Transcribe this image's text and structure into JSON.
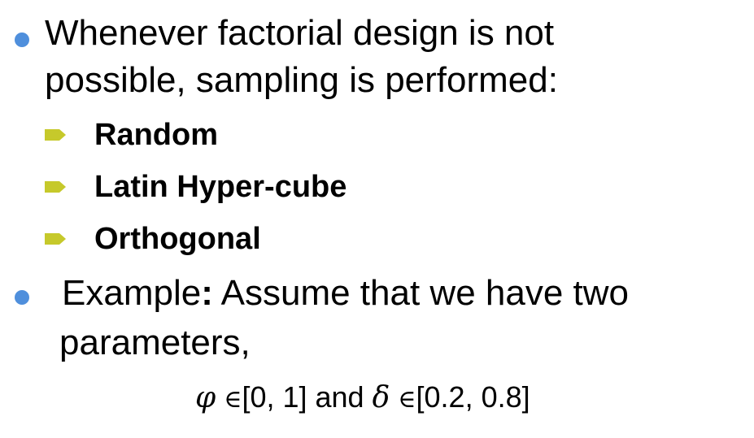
{
  "colors": {
    "bullet": "#4f8fdc",
    "sub_arrow": "#c6c92b",
    "text": "#000000"
  },
  "icons": {
    "main_bullet": "blue-dot",
    "sub_bullet": "olive-arrow"
  },
  "bullet1": {
    "line1": "Whenever factorial design is not",
    "line2": "possible, sampling is performed:"
  },
  "sub_items": [
    {
      "label": "Random"
    },
    {
      "label": "Latin Hyper-cube"
    },
    {
      "label": "Orthogonal"
    }
  ],
  "bullet2": {
    "prefix": "Example",
    "colon": ":",
    "rest": " Assume that we have two",
    "line2": "parameters,"
  },
  "formula": {
    "sym1": "φ",
    "in1": "∈",
    "range1": "[0, 1]",
    "and": " and ",
    "sym2": "δ",
    "in2": "∈",
    "range2": "[0.2, 0.8]"
  }
}
